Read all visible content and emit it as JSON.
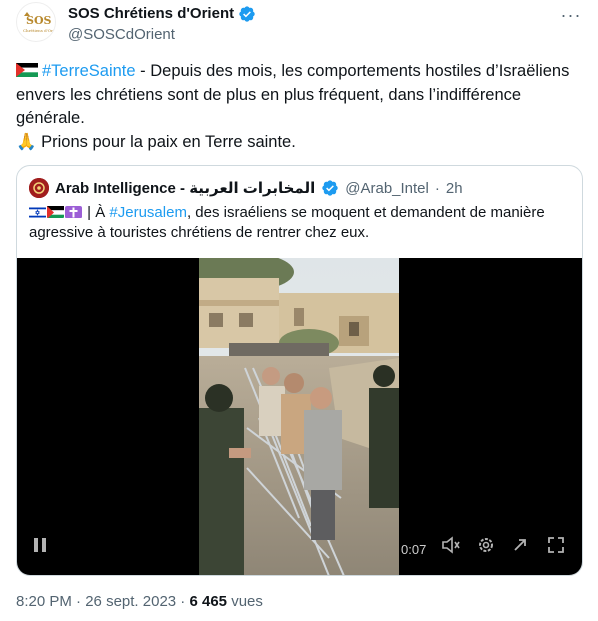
{
  "author": {
    "display_name": "SOS Chrétiens d'Orient",
    "handle": "@SOSCdOrient",
    "avatar_text": "SOS",
    "avatar_subtext": "Chrétiens d'Orient"
  },
  "tweet": {
    "hashtag": "#TerreSainte",
    "line1_rest": " - Depuis des mois, les comportements hostiles d’Israëliens envers les chrétiens sont de plus en plus fréquent, dans l’indifférence générale.",
    "line2_emoji": "🙏",
    "line2_text": " Prions pour la paix en Terre sainte."
  },
  "quote": {
    "display_name": "Arab Intelligence - المخابرات العربية",
    "handle": "@Arab_Intel",
    "separator": "·",
    "time": "2h",
    "text_prefix": " | À ",
    "hashtag": "#Jerusalem",
    "text_rest": ", des israéliens se moquent et demandent de manière agressive à touristes chrétiens de rentrer chez eux.",
    "video_timecode": "0:07"
  },
  "footer": {
    "time": "8:20 PM",
    "dot1": " · ",
    "date": "26 sept. 2023",
    "dot2": " · ",
    "views_count": "6 465",
    "views_label": " vues"
  },
  "colors": {
    "accent": "#1d9bf0",
    "text_primary": "#0f1419",
    "text_secondary": "#536471",
    "border": "#cfd9de"
  }
}
